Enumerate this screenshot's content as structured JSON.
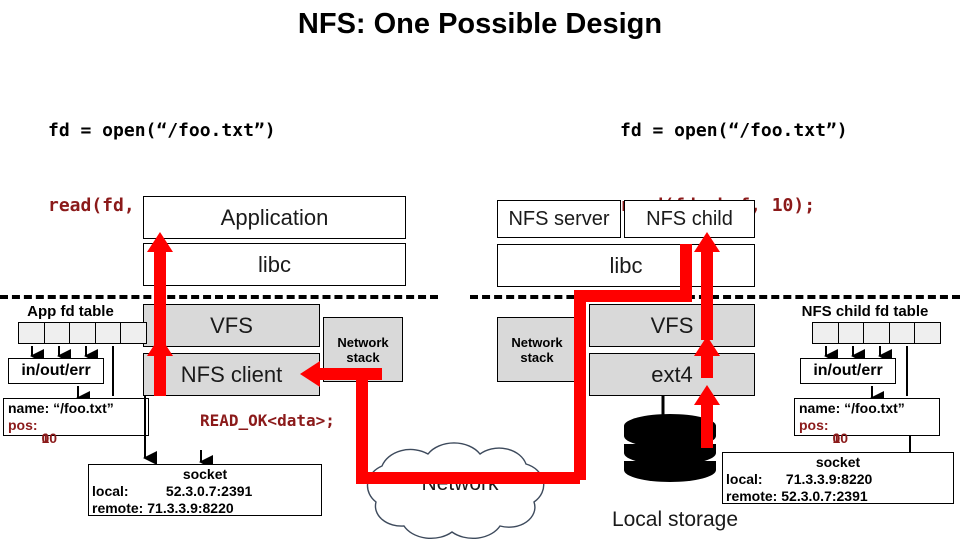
{
  "title": "NFS: One Possible Design",
  "code_left": {
    "line1": "fd = open(“/foo.txt”)",
    "line2": "read(fd, buf, 10);"
  },
  "code_right": {
    "line1": "fd = open(“/foo.txt”)",
    "line2": "read(fd, buf, 10);"
  },
  "client": {
    "application": "Application",
    "libc": "libc",
    "vfs": "VFS",
    "nfs_client": "NFS client",
    "network_stack_line1": "Network",
    "network_stack_line2": "stack",
    "fd_table_title": "App fd table",
    "in_out_err": "in/out/err",
    "file_name": "name: “/foo.txt”",
    "file_pos_label": "pos:",
    "file_pos_under": "0",
    "file_pos_over": "10",
    "socket_header": "socket",
    "socket_local_label": "local:",
    "socket_local_value": "52.3.0.7:2391",
    "socket_remote_label": "remote:",
    "socket_remote_value": "71.3.3.9:8220"
  },
  "server": {
    "nfs_server": "NFS server",
    "nfs_child": "NFS child",
    "libc": "libc",
    "vfs": "VFS",
    "ext4": "ext4",
    "network_stack_line1": "Network",
    "network_stack_line2": "stack",
    "fd_table_title": "NFS child fd table",
    "in_out_err": "in/out/err",
    "file_name": "name: “/foo.txt”",
    "file_pos_label": "pos:",
    "file_pos_under": "0",
    "file_pos_over": "10",
    "socket_header": "socket",
    "socket_local_label": "local:",
    "socket_local_value": "71.3.3.9:8220",
    "socket_remote_label": "remote:",
    "socket_remote_value": "52.3.0.7:2391",
    "local_storage": "Local storage"
  },
  "network": {
    "label": "Network"
  },
  "message": {
    "read_ok": "READ_OK<data>;"
  },
  "colors": {
    "red_arrow": "#FF0000",
    "dark_red_text": "#8B1A1A",
    "gray_box": "#d9d9d9",
    "fd_cell": "#efefef",
    "black": "#000000",
    "cloud_stroke": "#3d4a5c"
  }
}
